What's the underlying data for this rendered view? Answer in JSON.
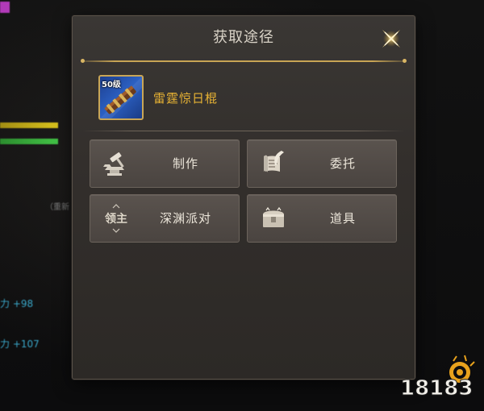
{
  "background": {
    "left": {
      "cyan_line_1": "力 +98",
      "cyan_line_2": "力 +107",
      "bracket_text": "（重新"
    }
  },
  "dialog": {
    "title": "获取途径",
    "item": {
      "level_badge": "50级",
      "name": "雷霆惊日棍"
    },
    "sources": [
      {
        "label": "制作",
        "icon": "anvil-hammer-icon"
      },
      {
        "label": "委托",
        "icon": "scroll-quill-icon"
      },
      {
        "label": "深渊派对",
        "icon_text": "领主",
        "icon": "lord-icon"
      },
      {
        "label": "道具",
        "icon": "treasure-chest-icon"
      }
    ]
  },
  "watermark": {
    "text": "18183"
  },
  "colors": {
    "dialog_bg": "#332f2c",
    "gold_accent": "#c8a454",
    "item_name": "#e7b234",
    "button_bg": "#524b46"
  }
}
